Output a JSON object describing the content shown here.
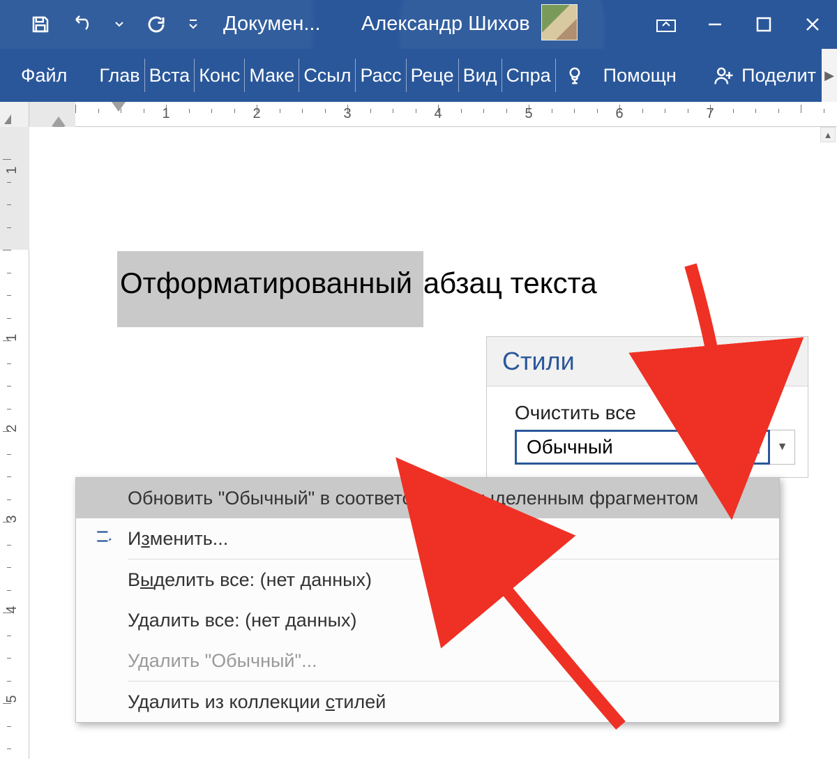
{
  "titlebar": {
    "doc_title": "Докумен...",
    "user_name": "Александр Шихов"
  },
  "ribbon": {
    "file": "Файл",
    "tabs": [
      "Глав",
      "Вста",
      "Конс",
      "Маке",
      "Ссыл",
      "Расс",
      "Реце",
      "Вид",
      "Спра"
    ],
    "help": "Помощн",
    "share": "Поделит"
  },
  "ruler": {
    "h_numbers": [
      "1",
      "2",
      "3",
      "4",
      "5",
      "6",
      "7"
    ],
    "v_numbers": [
      "1",
      "1",
      "2",
      "3",
      "4",
      "5"
    ]
  },
  "document": {
    "paragraph_selected": "Отформатированный ",
    "paragraph_rest": "абзац текста"
  },
  "styles_pane": {
    "title": "Стили",
    "clear_all": "Очистить все",
    "current_style": "Обычный"
  },
  "context_menu": {
    "update": "Обновить \"Обычный\" в соответствии с выделенным фрагментом",
    "modify_pre": "И",
    "modify_u": "з",
    "modify_post": "менить...",
    "select_all_pre": "В",
    "select_all_u": "ы",
    "select_all_post": "делить все: (нет данных)",
    "remove_all": "Удалить все: (нет данных)",
    "delete_style": "Удалить \"Обычный\"...",
    "remove_gallery_pre": "Удалить из коллекции ",
    "remove_gallery_u": "с",
    "remove_gallery_post": "тилей"
  }
}
